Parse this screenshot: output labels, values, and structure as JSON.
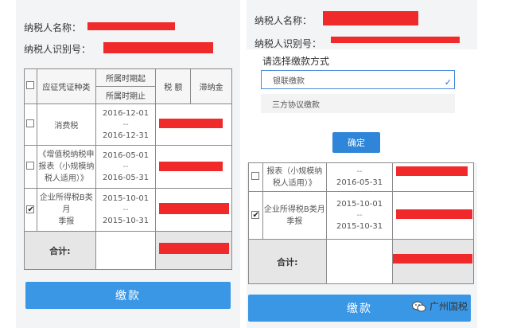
{
  "info": {
    "name_label": "纳税人名称：",
    "id_label": "纳税人识别号："
  },
  "table": {
    "headers": {
      "type": "应征凭证种类",
      "period_start": "所属时期起",
      "period_end": "所属时期止",
      "tax_amount": "税 额",
      "late_fee": "滞纳金"
    },
    "rows": [
      {
        "checked": false,
        "type": "消费税",
        "start": "2016-12-01",
        "sep": "--",
        "end": "2016-12-31"
      },
      {
        "checked": false,
        "type": "《增值税纳税申报表（小规模纳税人适用）》",
        "type_lines": [
          "《增值税纳税申",
          "报表（小规模纳",
          "税人适用）》"
        ],
        "start": "2016-05-01",
        "sep": "--",
        "end": "2016-05-31"
      },
      {
        "checked": true,
        "type": "企业所得税B类月季报",
        "type_lines": [
          "企业所得税B类月",
          "季报"
        ],
        "start": "2015-10-01",
        "sep": "--",
        "end": "2015-10-31"
      }
    ],
    "total_label": "合计:",
    "right_partial_row": {
      "checked": false,
      "type_lines": [
        "报表（小规模纳",
        "税人适用）》"
      ],
      "sep": "--",
      "end": "2016-05-31"
    }
  },
  "dialog": {
    "title": "请选择缴款方式",
    "options": [
      {
        "label": "银联缴款",
        "selected": true
      },
      {
        "label": "三方协议缴款",
        "selected": false
      }
    ],
    "confirm_label": "确定"
  },
  "pay_button_label": "缴款",
  "watermark": "广州国税",
  "colors": {
    "accent": "#3a97e6",
    "redaction": "#f02a2a"
  }
}
